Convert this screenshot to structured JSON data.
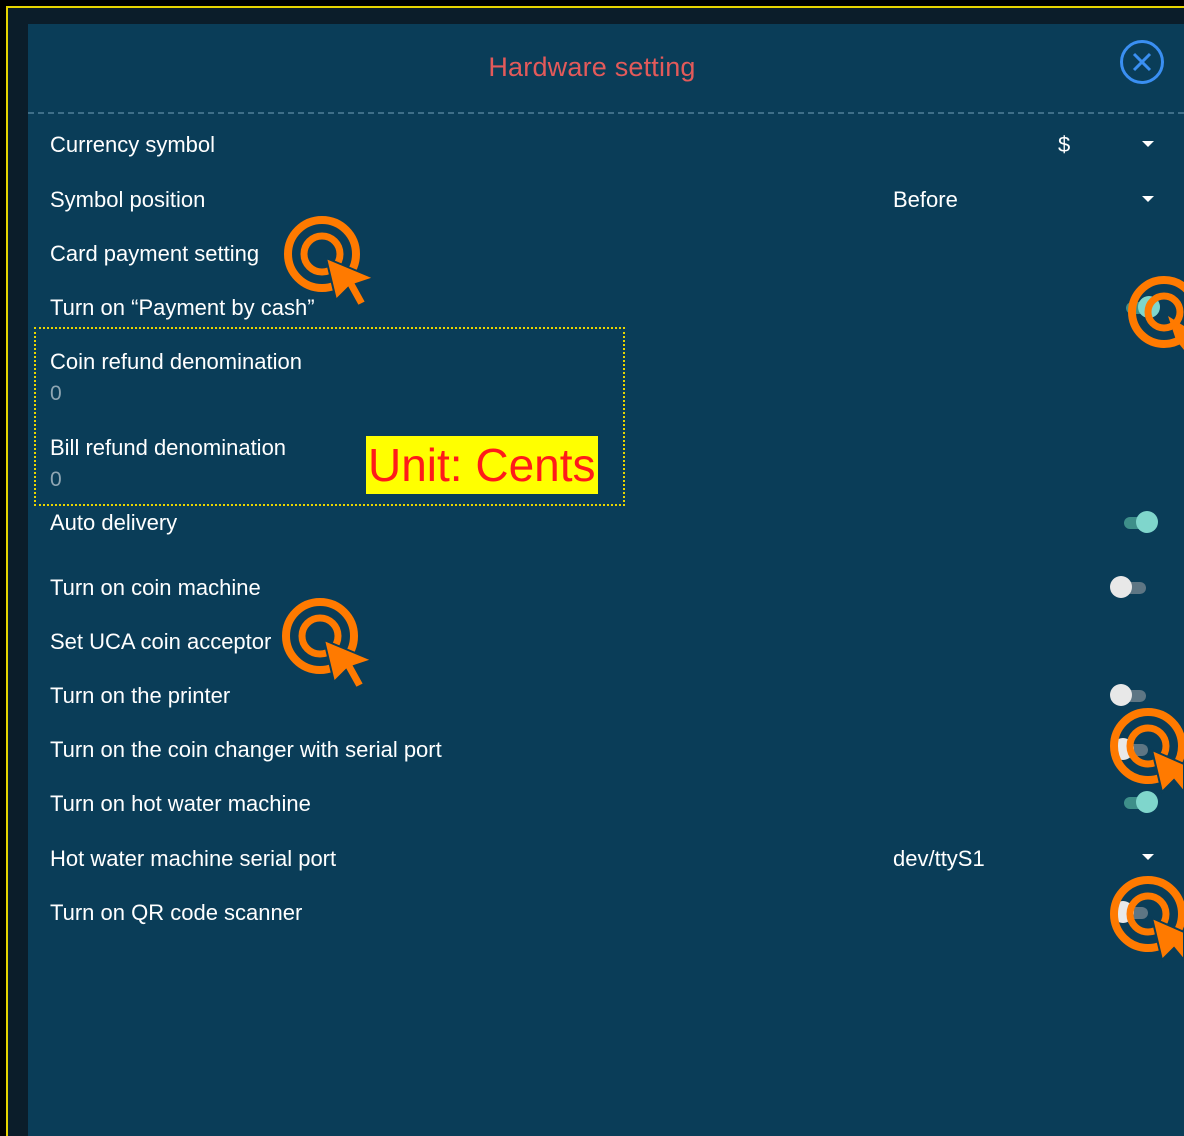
{
  "dialog": {
    "title": "Hardware setting"
  },
  "settings": {
    "currency_symbol": {
      "label": "Currency symbol",
      "value": "$"
    },
    "symbol_position": {
      "label": "Symbol position",
      "value": "Before"
    },
    "card_payment": {
      "label": "Card payment setting"
    },
    "payment_by_cash": {
      "label": "Turn on “Payment by cash”",
      "enabled": true
    },
    "coin_refund": {
      "label": "Coin refund denomination",
      "value": "0"
    },
    "bill_refund": {
      "label": "Bill refund denomination",
      "value": "0"
    },
    "auto_delivery": {
      "label": "Auto delivery",
      "enabled": true
    },
    "coin_machine": {
      "label": "Turn on coin machine",
      "enabled": false
    },
    "uca_coin_acceptor": {
      "label": "Set UCA coin acceptor"
    },
    "printer": {
      "label": "Turn on the printer",
      "enabled": false
    },
    "coin_changer_serial": {
      "label": "Turn on the coin changer with serial port",
      "enabled": false
    },
    "hot_water_machine": {
      "label": "Turn on hot water machine",
      "enabled": true
    },
    "hot_water_serial_port": {
      "label": "Hot water machine serial port",
      "value": "dev/ttyS1"
    },
    "qr_code_scanner": {
      "label": "Turn on QR code scanner",
      "enabled": false
    }
  },
  "annotation": {
    "unit_note": "Unit: Cents"
  },
  "colors": {
    "panel_bg": "#0a3d58",
    "title": "#e35a5a",
    "close_icon": "#3a8ff2",
    "toggle_on": "#7fd6cc",
    "tap_indicator": "#ff7a00",
    "annotation_border": "#e8d400",
    "note_bg": "#ffff00",
    "note_text": "#ff1a1a"
  },
  "icons": {
    "close": "close-icon",
    "dropdown": "caret-down-icon",
    "tap_hint": "tap-indicator-icon"
  }
}
